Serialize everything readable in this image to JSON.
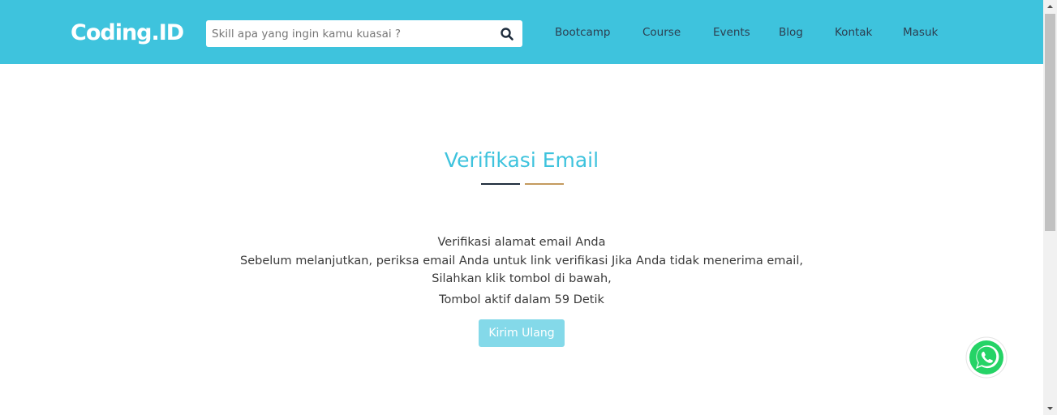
{
  "header": {
    "logo_text": "Coding.ID",
    "search": {
      "placeholder": "Skill apa yang ingin kamu kuasai ?",
      "value": ""
    },
    "search_icon": "search-icon",
    "nav": {
      "bootcamp": "Bootcamp",
      "course": "Course",
      "events": "Events",
      "blog": "Blog",
      "kontak": "Kontak",
      "masuk": "Masuk"
    }
  },
  "main": {
    "title": "Verifikasi Email",
    "line1": "Verifikasi alamat email Anda",
    "line2": "Sebelum melanjutkan, periksa email Anda untuk link verifikasi Jika Anda tidak menerima email,",
    "line3": "Silahkan klik tombol di bawah,",
    "countdown": "Tombol aktif dalam 59 Detik",
    "resend_button": "Kirim Ulang"
  },
  "floating": {
    "icon": "whatsapp-icon"
  },
  "colors": {
    "brand": "#3ec3dd",
    "nav_text": "#2c3e50",
    "underline_dark": "#1f2d3d",
    "underline_gold": "#c49a5e",
    "button_disabled": "#84d9e9",
    "whatsapp": "#25d366"
  }
}
